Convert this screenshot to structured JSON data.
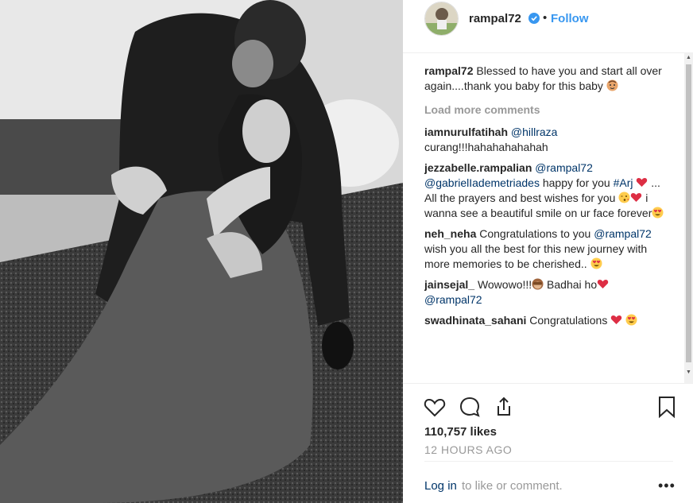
{
  "post": {
    "username": "rampal72",
    "follow_label": "Follow",
    "dot": "•",
    "caption": {
      "user": "rampal72",
      "text": "Blessed to have you and start all over again....thank you baby for this baby"
    },
    "load_more": "Load more comments",
    "comments": [
      {
        "user": "iamnurulfatihah",
        "mention": "@hillraza",
        "text": "curang!!!hahahahahahah"
      },
      {
        "user": "jezzabelle.rampalian",
        "mention": "@rampal72",
        "mention2": "@gabrielIademetriades",
        "text1": "happy for you",
        "tag": "#Arj",
        "text2": "... All the prayers and best wishes for you",
        "text3": "i wanna see a beautiful smile on ur face forever"
      },
      {
        "user": "neh_neha",
        "text1": "Congratulations to you",
        "mention": "@rampal72",
        "text2": "wish you all the best for this new journey with more memories to be cherished.."
      },
      {
        "user": "jainsejal_",
        "text1": "Wowowo!!!",
        "text2": "Badhai ho",
        "mention": "@rampal72"
      },
      {
        "user": "swadhinata_sahani",
        "text": "Congratulations"
      }
    ],
    "likes": "110,757 likes",
    "time": "12 HOURS AGO",
    "login_label": "Log in",
    "login_suffix": "to like or comment.",
    "more": "•••"
  },
  "icons": [
    "verified-badge-icon",
    "heart-icon",
    "comment-icon",
    "share-icon",
    "bookmark-icon",
    "more-options-icon"
  ],
  "colors": {
    "link": "#3897f0",
    "mention": "#003569",
    "muted": "#999999",
    "heart": "#ed4956"
  }
}
